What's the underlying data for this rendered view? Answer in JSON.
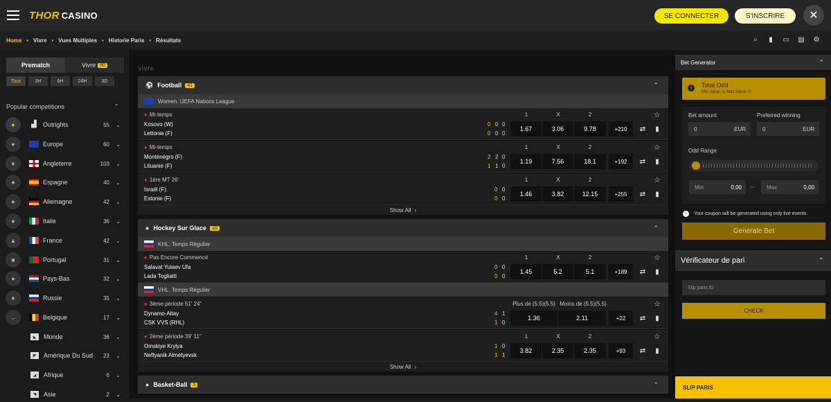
{
  "header": {
    "logo_mark": "THOR",
    "logo_text": "CASINO",
    "connect_label": "SE CONNECTER",
    "register_label": "S'INSCRIRE",
    "close_glyph": "✕"
  },
  "nav": {
    "items": [
      "Home",
      "Vivre",
      "Vues Multiples",
      "Historie Paris",
      "Résultats"
    ],
    "active": "Home",
    "icons": [
      "search-icon",
      "stats-icon",
      "monitor-icon",
      "calculator-icon",
      "gear-icon"
    ]
  },
  "sidebar": {
    "tabs": {
      "prematch": "Prematch",
      "vivre": "Vivre",
      "vivre_count": "90"
    },
    "filters": [
      "Tous",
      "3H",
      "6H",
      "24H",
      "3D"
    ],
    "active_filter": "Tous",
    "popular_title": "Popular competitions",
    "competitions": [
      {
        "name": "Outrights",
        "count": "55"
      },
      {
        "name": "Europe",
        "count": "60"
      },
      {
        "name": "Angleterre",
        "count": "103"
      },
      {
        "name": "Espagne",
        "count": "40"
      },
      {
        "name": "Allemagne",
        "count": "42"
      },
      {
        "name": "Italie",
        "count": "36"
      },
      {
        "name": "France",
        "count": "42"
      },
      {
        "name": "Portugal",
        "count": "31"
      },
      {
        "name": "Pays-Bas",
        "count": "32"
      },
      {
        "name": "Russie",
        "count": "35"
      },
      {
        "name": "Belgique",
        "count": "17"
      }
    ],
    "regions": [
      {
        "name": "Monde",
        "count": "36"
      },
      {
        "name": "Amérique Du Sud",
        "count": "23"
      },
      {
        "name": "Afrique",
        "count": "6"
      },
      {
        "name": "Asie",
        "count": "2"
      }
    ]
  },
  "main": {
    "heading": "vivre",
    "show_all": "Show All",
    "football": {
      "title": "Football",
      "count": "41",
      "league": "Women. UEFA Nations League",
      "matches": [
        {
          "status": "Mi-temps",
          "team1": "Kosovo (W)",
          "team2": "Lettonie (F)",
          "s1": [
            "0",
            "0",
            "0"
          ],
          "s2": [
            "0",
            "0",
            "0"
          ],
          "h1": "1",
          "hx": "X",
          "h2": "2",
          "o1": "1.67",
          "ox": "3.06",
          "o2": "9.78",
          "more": "+210"
        },
        {
          "status": "Mi-temps",
          "team1": "Monténégro (F)",
          "team2": "Lituanie (F)",
          "s1": [
            "2",
            "2",
            "0"
          ],
          "s2": [
            "1",
            "1",
            "0"
          ],
          "h1": "1",
          "hx": "X",
          "h2": "2",
          "o1": "1.19",
          "ox": "7.56",
          "o2": "18.1",
          "more": "+192"
        },
        {
          "status": "1ère MT 26'",
          "team1": "Israël (F)",
          "team2": "Estonie (F)",
          "s1": [
            "0",
            "0"
          ],
          "s2": [
            "0",
            "0"
          ],
          "h1": "1",
          "hx": "X",
          "h2": "2",
          "o1": "1.46",
          "ox": "3.82",
          "o2": "12.15",
          "more": "+255"
        }
      ]
    },
    "hockey": {
      "title": "Hockey Sur Glace",
      "count": "10",
      "league1": "KHL. Temps Régulier",
      "league2": "VHL. Temps Régulier",
      "match1": {
        "status": "Pas Encore Commencé",
        "team1": "Salavat Yulaev Ufa",
        "team2": "Lada Togliatti",
        "s1": [
          "0",
          "0"
        ],
        "s2": [
          "0",
          "0"
        ],
        "h1": "1",
        "hx": "X",
        "h2": "2",
        "o1": "1.45",
        "ox": "5.2",
        "o2": "5.1",
        "more": "+189"
      },
      "match2": {
        "status": "3ème période 51' 24\"",
        "team1": "Dynamo-Altay",
        "team2": "CSK VVS (RHL)",
        "s1": [
          "4",
          "1"
        ],
        "s2": [
          "1",
          "0"
        ],
        "h1": "Plus de (5.5)(5.5)",
        "h2": "Moins de (5.5)(5.5)",
        "o1": "1.36",
        "o2": "2.11",
        "more": "+22"
      },
      "match3": {
        "status": "2ème période 39' 11\"",
        "team1": "Omskiye Krylya",
        "team2": "Neftyanik Almetyevsk",
        "s1": [
          "1",
          "0"
        ],
        "s2": [
          "1",
          "1"
        ],
        "h1": "1",
        "hx": "X",
        "h2": "2",
        "o1": "3.82",
        "ox": "2.35",
        "o2": "2.35",
        "more": "+93"
      }
    },
    "basketball": {
      "title": "Basket-Ball",
      "count": "5"
    }
  },
  "right": {
    "bet_generator": "Bet Generator",
    "total_odd": "Total Odd",
    "total_odd_sub": "Min Value: 0, Max Value: 0",
    "bet_amount": "Bet amount",
    "preferred": "Preferred winning",
    "amount_value": "0",
    "preferred_value": "0",
    "currency": "EUR",
    "odd_range": "Odd Range",
    "min_label": "Min",
    "min_value": "0,00",
    "max_label": "Max",
    "max_value": "0,00",
    "range_sep": "—",
    "info": "Your coupon will be generated using only live events.",
    "generate": "Generate Bet",
    "verifier": "Vérificateur de pari",
    "slip_placeholder": "Slip paris ID",
    "check": "CHECK",
    "slip": "SLIP PARIS"
  }
}
